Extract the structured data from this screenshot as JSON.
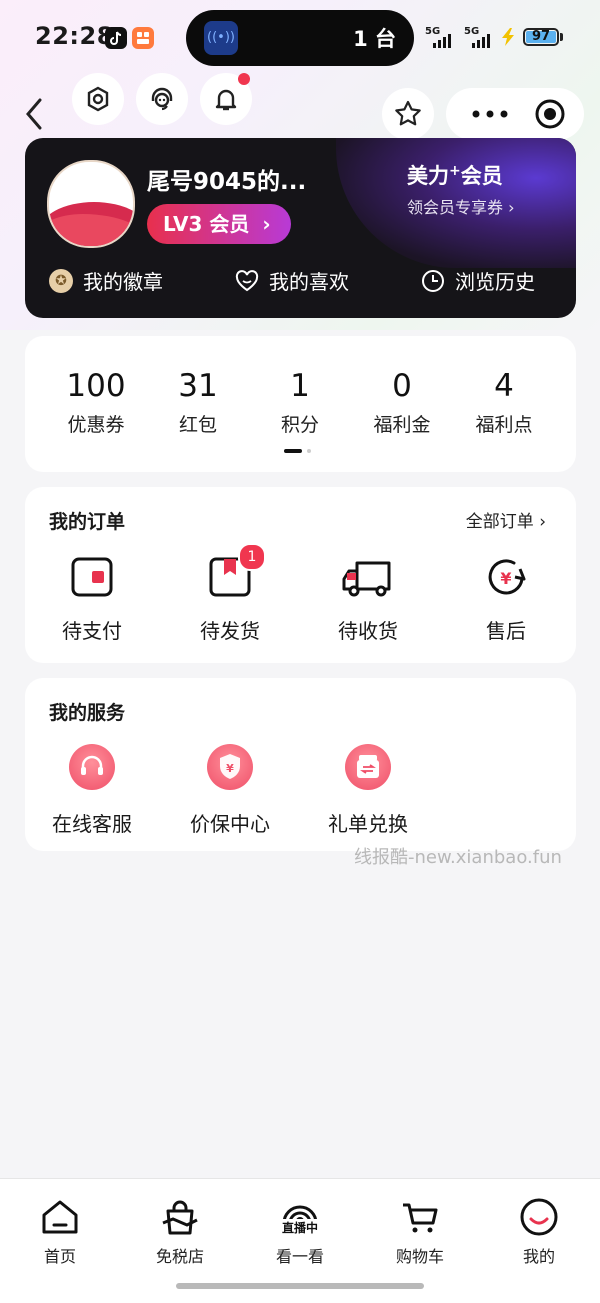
{
  "status_bar": {
    "time": "22:28",
    "island_count": "1 台",
    "network1": "5G",
    "network2": "5G",
    "battery": "97"
  },
  "nav": {
    "icons": [
      "settings-icon",
      "customer-service-icon",
      "bell-icon",
      "star-icon",
      "more-icon",
      "target-icon"
    ]
  },
  "member_card": {
    "username": "尾号9045的...",
    "level": "LV3 会员",
    "vip_title": "美力",
    "vip_title_sup": "+",
    "vip_title_suffix": "会员",
    "vip_sub": "领会员专享券",
    "links": [
      "我的徽章",
      "我的喜欢",
      "浏览历史"
    ]
  },
  "stats": [
    {
      "value": "100",
      "label": "优惠券"
    },
    {
      "value": "31",
      "label": "红包"
    },
    {
      "value": "1",
      "label": "积分"
    },
    {
      "value": "0",
      "label": "福利金"
    },
    {
      "value": "4",
      "label": "福利点"
    }
  ],
  "orders": {
    "title": "我的订单",
    "all_link": "全部订单",
    "items": [
      {
        "label": "待支付",
        "badge": ""
      },
      {
        "label": "待发货",
        "badge": "1"
      },
      {
        "label": "待收货",
        "badge": ""
      },
      {
        "label": "售后",
        "badge": ""
      }
    ]
  },
  "services": {
    "title": "我的服务",
    "items": [
      {
        "label": "在线客服"
      },
      {
        "label": "价保中心"
      },
      {
        "label": "礼单兑换"
      }
    ]
  },
  "watermark": "线报酷-new.xianbao.fun",
  "tabs": [
    {
      "label": "首页"
    },
    {
      "label": "免税店"
    },
    {
      "label": "看一看",
      "badge_text": "直播中"
    },
    {
      "label": "购物车"
    },
    {
      "label": "我的"
    }
  ],
  "colors": {
    "accent": "#f0364f",
    "dark_card": "#151418"
  }
}
